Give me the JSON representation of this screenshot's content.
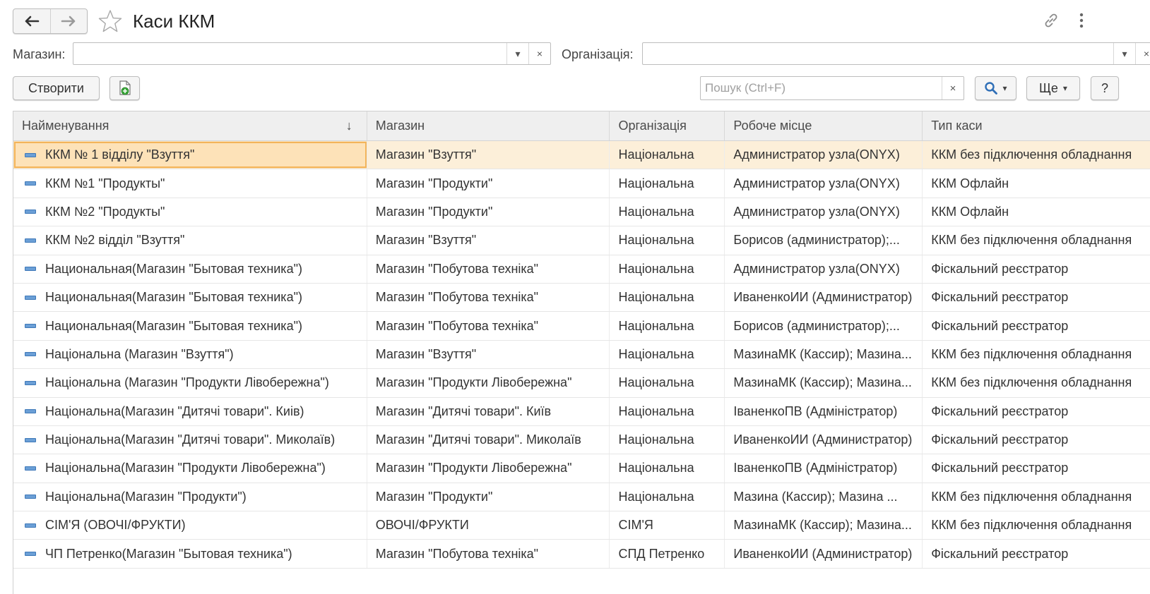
{
  "window": {
    "title": "Каси ККМ"
  },
  "icons": {
    "back": "arrow-left-icon",
    "forward": "arrow-right-icon",
    "favorite": "star-icon",
    "link": "link-icon",
    "more": "vertical-dots-icon",
    "create_copy": "document-add-icon",
    "search": "magnifier-icon"
  },
  "filters": {
    "store_label": "Магазин:",
    "store_value": "",
    "org_label": "Організація:",
    "org_value": ""
  },
  "toolbar": {
    "create_label": "Створити",
    "search_placeholder": "Пошук (Ctrl+F)",
    "search_value": "",
    "more_label": "Ще",
    "help_label": "?"
  },
  "table": {
    "columns": [
      "Найменування",
      "Магазин",
      "Організація",
      "Робоче місце",
      "Тип каси"
    ],
    "sort_indicator": "↓",
    "rows": [
      [
        "ККМ № 1 відділу \"Взуття\"",
        "Магазин \"Взуття\"",
        "Національна",
        "Администратор узла(ONYX)",
        "ККМ без підключення обладнання"
      ],
      [
        "ККМ №1 \"Продукты\"",
        "Магазин \"Продукти\"",
        "Національна",
        "Администратор узла(ONYX)",
        "ККМ Офлайн"
      ],
      [
        "ККМ №2 \"Продукты\"",
        "Магазин \"Продукти\"",
        "Національна",
        "Администратор узла(ONYX)",
        "ККМ Офлайн"
      ],
      [
        "ККМ №2 відділ \"Взуття\"",
        "Магазин \"Взуття\"",
        "Національна",
        "Борисов (администратор);...",
        "ККМ без підключення обладнання"
      ],
      [
        "Национальная(Магазин \"Бытовая техника\")",
        "Магазин \"Побутова техніка\"",
        "Національна",
        "Администратор узла(ONYX)",
        "Фіскальний реєстратор"
      ],
      [
        "Национальная(Магазин \"Бытовая техника\")",
        "Магазин \"Побутова техніка\"",
        "Національна",
        "ИваненкоИИ (Администратор)",
        "Фіскальний реєстратор"
      ],
      [
        "Национальная(Магазин \"Бытовая техника\")",
        "Магазин \"Побутова техніка\"",
        "Національна",
        "Борисов (администратор);...",
        "Фіскальний реєстратор"
      ],
      [
        "Національна (Магазин \"Взуття\")",
        "Магазин \"Взуття\"",
        "Національна",
        "МазинаМК (Кассир); Мазина...",
        "ККМ без підключення обладнання"
      ],
      [
        "Національна (Магазин \"Продукти Лівобережна\")",
        "Магазин \"Продукти Лівобережна\"",
        "Національна",
        "МазинаМК (Кассир); Мазина...",
        "ККМ без підключення обладнання"
      ],
      [
        "Національна(Магазин \"Дитячі товари\". Киів)",
        "Магазин \"Дитячі товари\". Київ",
        "Національна",
        "ІваненкоПВ (Адміністратор)",
        "Фіскальний реєстратор"
      ],
      [
        "Національна(Магазин \"Дитячі товари\". Миколаїв)",
        "Магазин \"Дитячі товари\". Миколаїв",
        "Національна",
        "ИваненкоИИ (Администратор)",
        "Фіскальний реєстратор"
      ],
      [
        "Національна(Магазин \"Продукти Лівобережна\")",
        "Магазин \"Продукти Лівобережна\"",
        "Національна",
        "ІваненкоПВ (Адміністратор)",
        "Фіскальний реєстратор"
      ],
      [
        "Національна(Магазин \"Продукти\")",
        "Магазин \"Продукти\"",
        "Національна",
        "Мазина (Кассир); Мазина ...",
        "ККМ без підключення обладнання"
      ],
      [
        "СІМ'Я (ОВОЧІ/ФРУКТИ)",
        "ОВОЧІ/ФРУКТИ",
        "СІМ'Я",
        "МазинаМК (Кассир); Мазина...",
        "ККМ без підключення обладнання"
      ],
      [
        "ЧП Петренко(Магазин \"Бытовая техника\")",
        "Магазин \"Побутова техніка\"",
        "СПД Петренко",
        "ИваненкоИИ (Администратор)",
        "Фіскальний реєстратор"
      ]
    ],
    "selected_row": 0
  },
  "colors": {
    "selected_row": "#fcefd9",
    "selected_cell_border": "#f3b45a",
    "header_bg": "#efefef",
    "item_icon": "#6b9fd6"
  }
}
